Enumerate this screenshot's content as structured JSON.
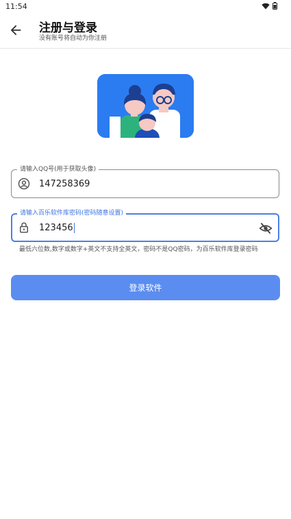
{
  "status_bar": {
    "time": "11:54",
    "wifi_icon": "wifi-icon",
    "battery_icon": "battery-icon"
  },
  "header": {
    "back_icon": "arrow-left-icon",
    "title": "注册与登录",
    "subtitle": "没有账号将自动为你注册"
  },
  "hero": {
    "image": "family-illustration",
    "background": "#2b7cf1"
  },
  "qq_field": {
    "label": "请输入QQ号(用于获取头像)",
    "value": "147258369",
    "icon": "account-circle-icon"
  },
  "password_field": {
    "label": "请输入百乐软件库密码(密码随意设置)",
    "value": "123456",
    "icon": "lock-icon",
    "toggle_icon": "eye-off-icon"
  },
  "hint": "最低六位数,数字或数字+英文不支持全英文，密码不是QQ密码，为百乐软件库登录密码",
  "login_button": {
    "label": "登录软件",
    "color": "#5b8df0"
  },
  "colors": {
    "accent": "#4a7fe6",
    "hero_bg": "#2b7cf1"
  }
}
